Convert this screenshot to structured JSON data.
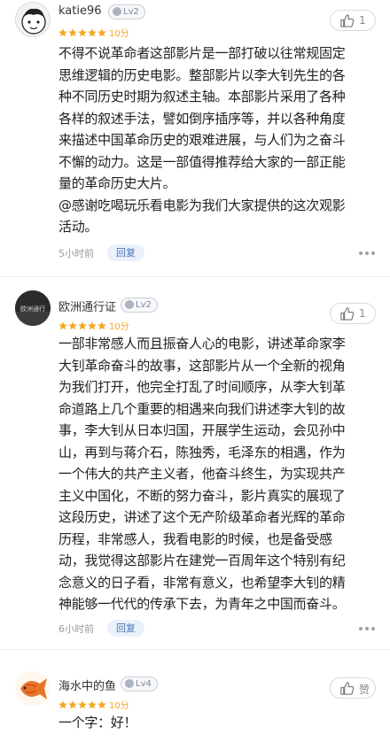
{
  "reviews": [
    {
      "username": "katie96",
      "level": "Lv2",
      "score_text": "10分",
      "rating_stars": 5,
      "likes": "1",
      "content_lines": [
        "不得不说革命者这部影片是一部打破以往常规固定",
        "思维逻辑的历史电影。整部影片以李大钊先生的各",
        "种不同历史时期为叙述主轴。本部影片采用了各种",
        "各样的叙述手法，譬如倒序插序等，并以各种角度",
        "来描述中国革命历史的艰难进展，与人们为之奋斗",
        "不懈的动力。这是一部值得推荐给大家的一部正能",
        "量的革命历史大片。",
        "@感谢吃喝玩乐看电影为我们大家提供的这次观影",
        "活动。"
      ],
      "time": "5小时前",
      "reply_label": "回复"
    },
    {
      "username": "欧洲通行证",
      "level": "Lv2",
      "score_text": "10分",
      "rating_stars": 5,
      "likes": "1",
      "avatar_text": "欧洲通行",
      "content_lines": [
        "一部非常感人而且振奋人心的电影，讲述革命家李",
        "大钊革命奋斗的故事，这部影片从一个全新的视角",
        "为我们打开，他完全打乱了时间顺序，从李大钊革",
        "命道路上几个重要的相遇来向我们讲述李大钊的故",
        "事，李大钊从日本归国，开展学生运动，会见孙中",
        "山，再到与蒋介石，陈独秀，毛泽东的相遇，作为",
        "一个伟大的共产主义者，他奋斗终生，为实现共产",
        "主义中国化，不断的努力奋斗，影片真实的展现了",
        "这段历史，讲述了这个无产阶级革命者光辉的革命",
        "历程，非常感人，我看电影的时候，也是备受感",
        "动，我觉得这部影片在建党一百周年这个特别有纪",
        "念意义的日子看，非常有意义，也希望李大钊的精",
        "神能够一代代的传承下去，为青年之中国而奋斗。"
      ],
      "time": "6小时前",
      "reply_label": "回复"
    },
    {
      "username": "海水中的鱼",
      "level": "Lv4",
      "score_text": "10分",
      "rating_stars": 5,
      "likes": "赞",
      "content_lines": [
        "一个字：好！"
      ]
    }
  ],
  "colors": {
    "star": "#f5a623",
    "reply_bg": "#eaf1fb",
    "reply_text": "#4a76b9"
  }
}
